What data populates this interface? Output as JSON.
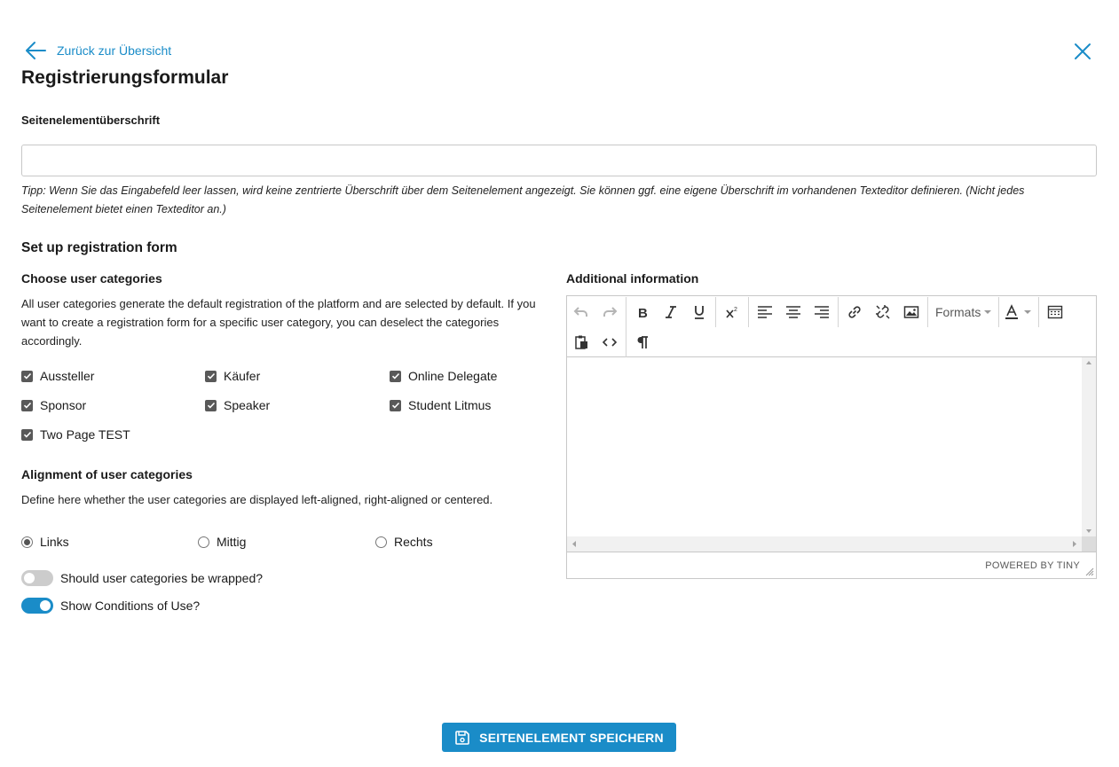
{
  "nav": {
    "back_label": "Zurück zur Übersicht"
  },
  "page_title": "Registrierungsformular",
  "heading_field": {
    "label": "Seitenelementüberschrift",
    "value": "",
    "placeholder": "",
    "tip": "Tipp: Wenn Sie das Eingabefeld leer lassen, wird keine zentrierte Überschrift über dem Seitenelement angezeigt. Sie können ggf. eine eigene Überschrift im vorhandenen Texteditor definieren. (Nicht jedes Seitenelement bietet einen Texteditor an.)"
  },
  "setup": {
    "title": "Set up registration form",
    "categories_title": "Choose user categories",
    "categories_desc": "All user categories generate the default registration of the platform and are selected by default. If you want to create a registration form for a specific user category, you can deselect the categories accordingly.",
    "categories": [
      {
        "label": "Aussteller",
        "checked": true
      },
      {
        "label": "Käufer",
        "checked": true
      },
      {
        "label": "Online Delegate",
        "checked": true
      },
      {
        "label": "Sponsor",
        "checked": true
      },
      {
        "label": "Speaker",
        "checked": true
      },
      {
        "label": "Student Litmus",
        "checked": true
      },
      {
        "label": "Two Page TEST",
        "checked": true
      }
    ],
    "alignment_title": "Alignment of user categories",
    "alignment_desc": "Define here whether the user categories are displayed left-aligned, right-aligned or centered.",
    "alignment_options": [
      {
        "label": "Links",
        "selected": true
      },
      {
        "label": "Mittig",
        "selected": false
      },
      {
        "label": "Rechts",
        "selected": false
      }
    ],
    "toggles": [
      {
        "label": "Should user categories be wrapped?",
        "on": false
      },
      {
        "label": "Show Conditions of Use?",
        "on": true
      }
    ]
  },
  "additional": {
    "title": "Additional information",
    "formats_label": "Formats",
    "powered_by": "POWERED BY TINY"
  },
  "save_button": {
    "label": "SEITENELEMENT SPEICHERN"
  },
  "colors": {
    "accent": "#1a8cc8",
    "toggle_off": "#cccccc",
    "checkbox": "#595959"
  }
}
